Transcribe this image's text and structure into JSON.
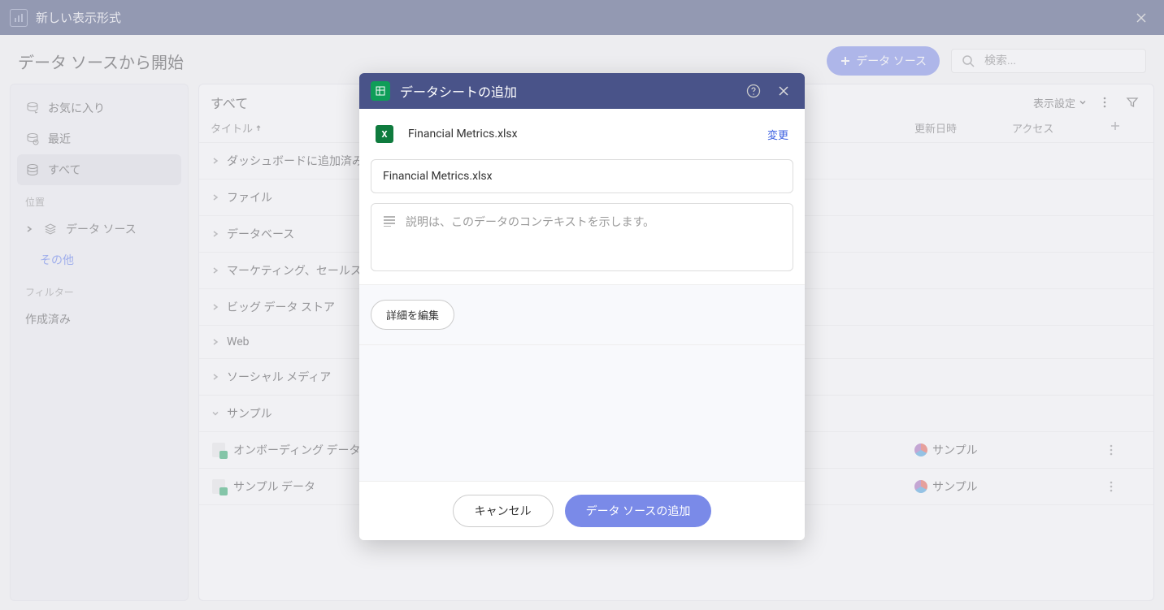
{
  "header": {
    "title": "新しい表示形式"
  },
  "page": {
    "title": "データ ソースから開始",
    "addButton": "データ ソース",
    "searchPlaceholder": "検索..."
  },
  "sidebar": {
    "favorites": "お気に入り",
    "recent": "最近",
    "all": "すべて",
    "locationLabel": "位置",
    "dataSources": "データ ソース",
    "other": "その他",
    "filterLabel": "フィルター",
    "created": "作成済み"
  },
  "content": {
    "title": "すべて",
    "displaySettings": "表示設定",
    "colTitle": "タイトル",
    "colUpdated": "更新日時",
    "colAccess": "アクセス",
    "rows": {
      "dashboard": "ダッシュボードに追加済み",
      "file": "ファイル",
      "database": "データベース",
      "marketing": "マーケティング、セールス",
      "bigdata": "ビッグ データ ストア",
      "web": "Web",
      "social": "ソーシャル メディア",
      "sample": "サンプル",
      "onboarding": "オンボーディング データ",
      "sampleData": "サンプル データ",
      "sampleBadge": "サンプル"
    }
  },
  "modal": {
    "title": "データシートの追加",
    "fileName": "Financial Metrics.xlsx",
    "changeLink": "変更",
    "nameInput": "Financial Metrics.xlsx",
    "descPlaceholder": "説明は、このデータのコンテキストを示します。",
    "detailBtn": "詳細を編集",
    "cancel": "キャンセル",
    "confirm": "データ ソースの追加"
  }
}
